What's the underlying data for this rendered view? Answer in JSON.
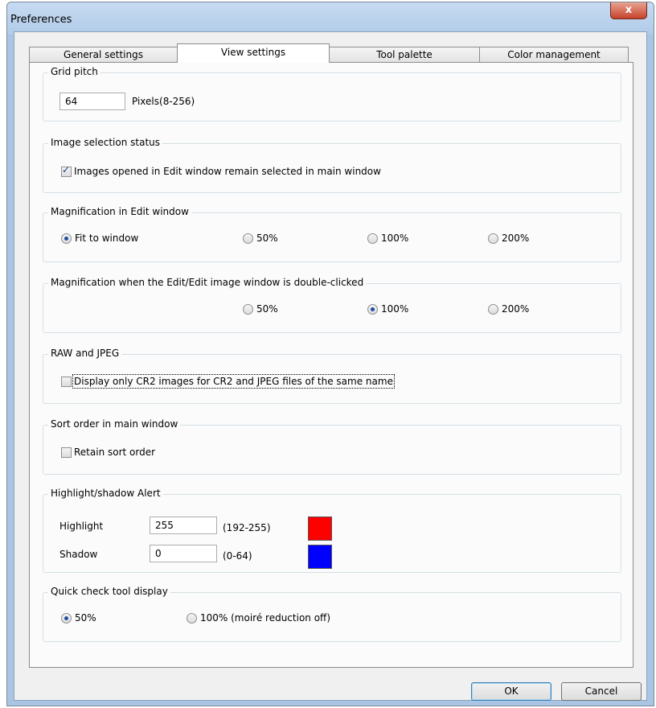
{
  "window": {
    "title": "Preferences",
    "close_glyph": "x"
  },
  "tabs": [
    {
      "label": "General settings"
    },
    {
      "label": "View settings"
    },
    {
      "label": "Tool palette"
    },
    {
      "label": "Color management"
    }
  ],
  "active_tab": "View settings",
  "grid_pitch": {
    "title": "Grid pitch",
    "value": "64",
    "range_label": "Pixels(8-256)"
  },
  "image_selection": {
    "title": "Image selection status",
    "checkbox_label": "Images opened in Edit window remain selected in main window",
    "checked": true
  },
  "magnification_edit": {
    "title": "Magnification in Edit window",
    "options": [
      {
        "label": "Fit to window",
        "selected": true
      },
      {
        "label": "50%",
        "selected": false
      },
      {
        "label": "100%",
        "selected": false
      },
      {
        "label": "200%",
        "selected": false
      }
    ]
  },
  "magnification_double_click": {
    "title": "Magnification when the Edit/Edit image window is double-clicked",
    "options": [
      {
        "label": "50%",
        "selected": false
      },
      {
        "label": "100%",
        "selected": true
      },
      {
        "label": "200%",
        "selected": false
      }
    ]
  },
  "raw_jpeg": {
    "title": "RAW and JPEG",
    "checkbox_label": "Display only CR2 images for CR2 and JPEG files of the same name",
    "checked": false
  },
  "sort_order": {
    "title": "Sort order in main window",
    "checkbox_label": "Retain sort order",
    "checked": false
  },
  "alert": {
    "title": "Highlight/shadow Alert",
    "highlight": {
      "label": "Highlight",
      "value": "255",
      "range": "(192-255)",
      "color": "#ff0000"
    },
    "shadow": {
      "label": "Shadow",
      "value": "0",
      "range": "(0-64)",
      "color": "#0000ff"
    }
  },
  "quick_check": {
    "title": "Quick check tool display",
    "options": [
      {
        "label": "50%",
        "selected": true
      },
      {
        "label": "100% (moiré reduction off)",
        "selected": false
      }
    ]
  },
  "buttons": {
    "ok": "OK",
    "cancel": "Cancel"
  }
}
